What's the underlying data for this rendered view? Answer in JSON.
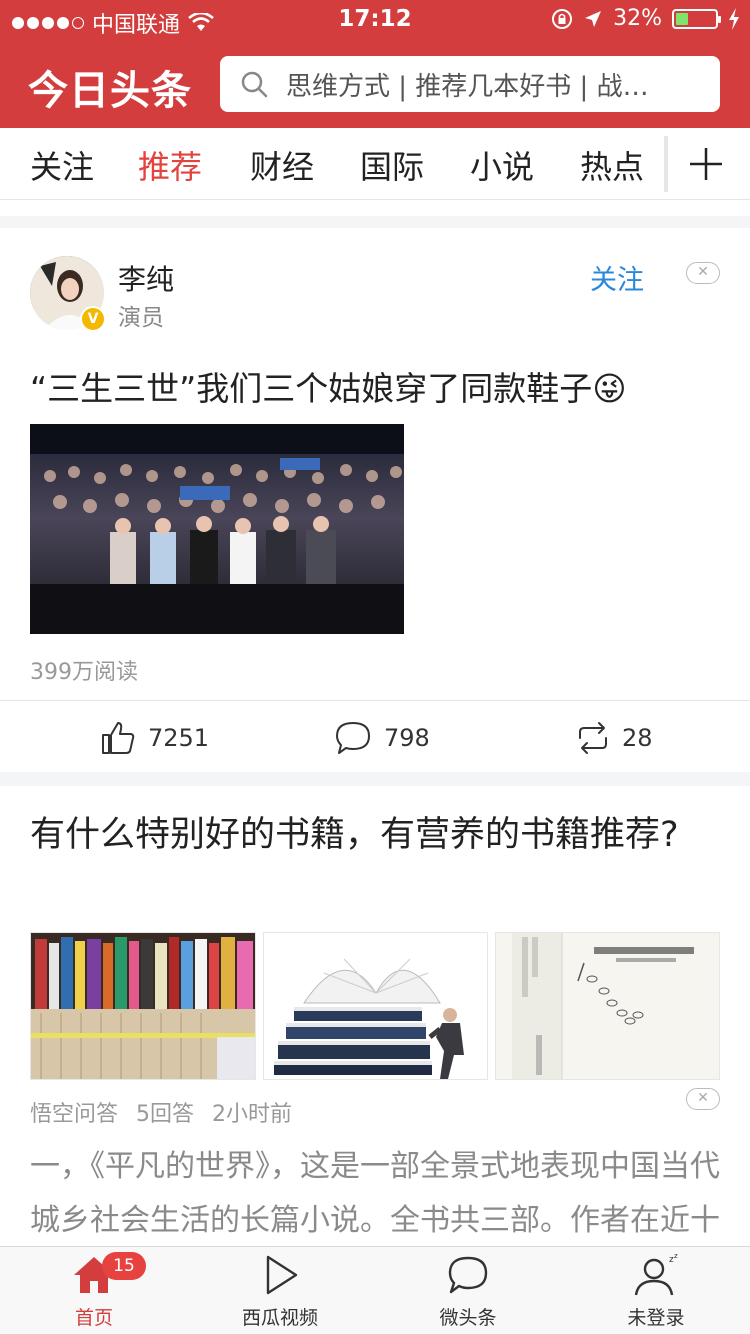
{
  "status_bar": {
    "carrier": "中国联通",
    "time": "17:12",
    "battery": "32%",
    "battery_level": 0.32
  },
  "header": {
    "logo": "今日头条",
    "search_text": "思维方式 | 推荐几本好书 | 战…"
  },
  "tabs": [
    {
      "label": "关注"
    },
    {
      "label": "推荐"
    },
    {
      "label": "财经"
    },
    {
      "label": "国际"
    },
    {
      "label": "小说"
    },
    {
      "label": "热点"
    }
  ],
  "post": {
    "author": "李纯",
    "author_title": "演员",
    "follow_label": "关注",
    "title": "“三生三世”我们三个姑娘穿了同款鞋子😜",
    "reads": "399万阅读",
    "likes": "7251",
    "comments": "798",
    "shares": "28"
  },
  "question": {
    "title": "有什么特别好的书籍，有营养的书籍推荐?",
    "source": "悟空问答",
    "answers": "5回答",
    "time": "2小时前",
    "excerpt": "一，《平凡的世界》，这是一部全景式地表现中国当代城乡社会生活的长篇小说。全书共三部。作者在近十年间广阔背景上，通过复杂的矛盾纠葛，刻"
  },
  "bottom_nav": [
    {
      "label": "首页",
      "icon": "home-icon"
    },
    {
      "label": "西瓜视频",
      "icon": "play-icon"
    },
    {
      "label": "微头条",
      "icon": "chat-icon"
    },
    {
      "label": "未登录",
      "icon": "user-icon"
    }
  ],
  "home_badge": "15",
  "colors": {
    "brand_red": "#d33d3e",
    "active_tab": "#e2433f",
    "follow_blue": "#2b87de"
  }
}
